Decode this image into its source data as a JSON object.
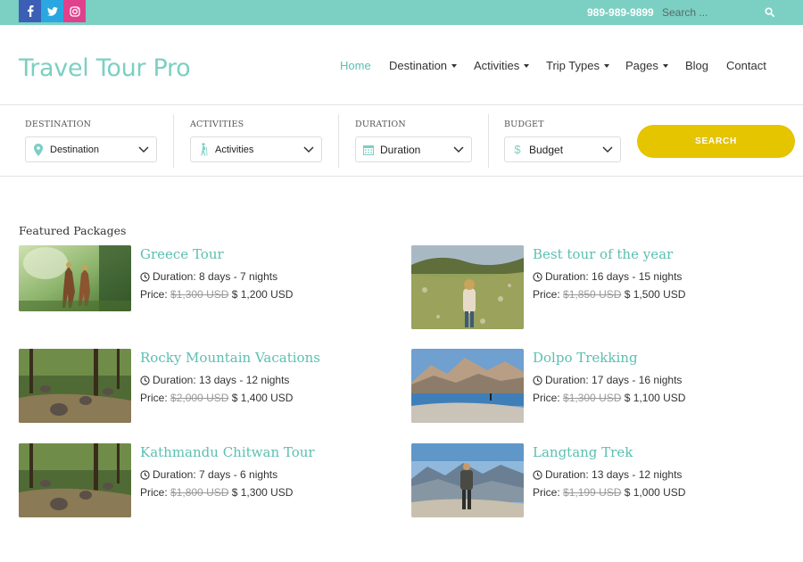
{
  "topbar": {
    "social": [
      {
        "name": "facebook-icon",
        "glyph": "f"
      },
      {
        "name": "twitter-icon",
        "glyph": "t"
      },
      {
        "name": "instagram-icon",
        "glyph": "i"
      }
    ],
    "phone": "989-989-9899",
    "search_placeholder": "Search ..."
  },
  "header": {
    "logo": "Travel Tour Pro",
    "nav": [
      {
        "label": "Home",
        "dropdown": false,
        "active": true
      },
      {
        "label": "Destination",
        "dropdown": true,
        "active": false
      },
      {
        "label": "Activities",
        "dropdown": true,
        "active": false
      },
      {
        "label": "Trip Types",
        "dropdown": true,
        "active": false
      },
      {
        "label": "Pages",
        "dropdown": true,
        "active": false
      },
      {
        "label": "Blog",
        "dropdown": false,
        "active": false
      },
      {
        "label": "Contact",
        "dropdown": false,
        "active": false
      }
    ]
  },
  "filters": [
    {
      "label": "DESTINATION",
      "value": "Destination",
      "icon": "map-pin-icon"
    },
    {
      "label": "ACTIVITIES",
      "value": "Activities",
      "icon": "hiker-icon"
    },
    {
      "label": "DURATION",
      "value": "Duration",
      "icon": "calendar-icon"
    },
    {
      "label": "BUDGET",
      "value": "Budget",
      "icon": "dollar-icon"
    }
  ],
  "search_button": "SEARCH",
  "featured": {
    "title": "Featured Packages",
    "packages": [
      {
        "title": "Greece Tour",
        "duration": "Duration: 8 days - 7 nights",
        "price_label": "Price:",
        "old_price": "$1,300 USD",
        "new_price": "$ 1,200 USD",
        "image": "dancers-in-forest-photo"
      },
      {
        "title": "Best tour of the year",
        "duration": "Duration: 16 days - 15 nights",
        "price_label": "Price:",
        "old_price": "$1,850 USD",
        "new_price": "$ 1,500 USD",
        "image": "woman-on-hillside-photo"
      },
      {
        "title": "Rocky Mountain Vacations",
        "duration": "Duration: 13 days - 12 nights",
        "price_label": "Price:",
        "old_price": "$2,000 USD",
        "new_price": "$ 1,400 USD",
        "image": "jungle-elephants-photo"
      },
      {
        "title": "Dolpo Trekking",
        "duration": "Duration: 17 days - 16 nights",
        "price_label": "Price:",
        "old_price": "$1,300 USD",
        "new_price": "$ 1,100 USD",
        "image": "mountain-lake-photo"
      },
      {
        "title": "Kathmandu Chitwan Tour",
        "duration": "Duration: 7 days - 6 nights",
        "price_label": "Price:",
        "old_price": "$1,800 USD",
        "new_price": "$ 1,300 USD",
        "image": "jungle-elephants-photo"
      },
      {
        "title": "Langtang Trek",
        "duration": "Duration: 13 days - 12 nights",
        "price_label": "Price:",
        "old_price": "$1,199 USD",
        "new_price": "$ 1,000 USD",
        "image": "hiker-mountain-view-photo"
      }
    ]
  },
  "colors": {
    "accent": "#7ccfc3",
    "title_teal": "#5bbfb1",
    "search_button": "#e5c400",
    "facebook": "#3b5fb5",
    "twitter": "#2aa7e0",
    "instagram": "#e0418c"
  }
}
